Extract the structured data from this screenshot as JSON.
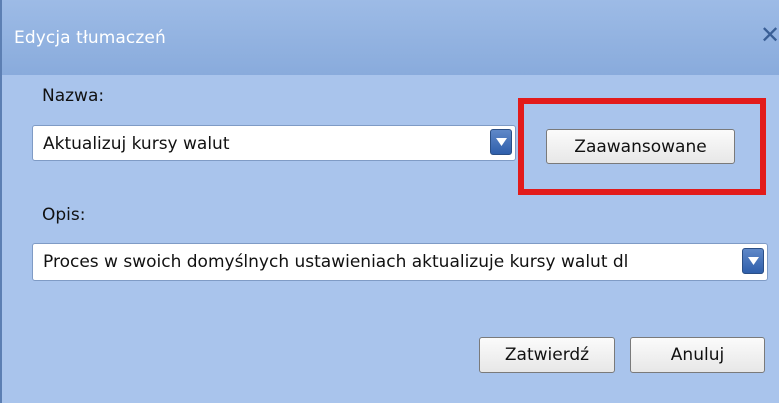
{
  "dialog": {
    "title": "Edycja tłumaczeń",
    "close_icon": "close-icon",
    "name_label": "Nazwa:",
    "name_value": "Aktualizuj kursy walut",
    "advanced_button": "Zaawansowane",
    "description_label": "Opis:",
    "description_value": "Proces w swoich domyślnych ustawieniach aktualizuje kursy walut dl",
    "confirm_button": "Zatwierdź",
    "cancel_button": "Anuluj"
  },
  "colors": {
    "title_bar": "#9dbbe6",
    "dialog_body": "#a9c4ec",
    "highlight": "#e21b1b"
  }
}
